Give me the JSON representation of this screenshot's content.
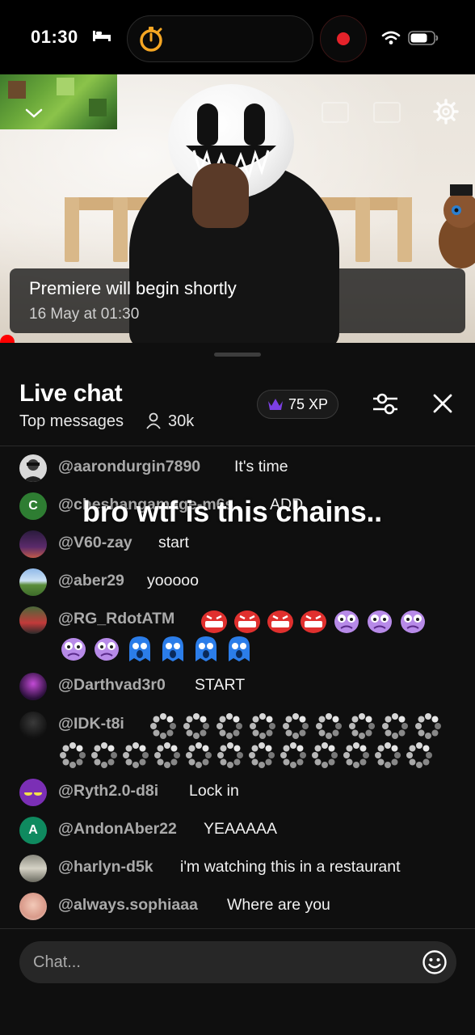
{
  "status_bar": {
    "time": "01:30",
    "icons": [
      "bed-icon",
      "timer-icon",
      "record-icon",
      "wifi-icon",
      "battery-icon"
    ]
  },
  "video": {
    "premiere_title": "Premiere will begin shortly",
    "premiere_date": "16 May at 01:30",
    "icons": [
      "collapse-chevron-icon",
      "settings-icon"
    ]
  },
  "chat": {
    "title": "Live chat",
    "mode": "Top messages",
    "viewers": "30k",
    "xp": "75 XP",
    "messages": [
      {
        "author": "@aarondurgin7890",
        "text": "It's time"
      },
      {
        "author": "@cheshangamage-m6s",
        "text": "ADD",
        "avatar_letter": "C",
        "avatar_color": "#2e7d32"
      },
      {
        "author": "@V60-zay",
        "text": "start"
      },
      {
        "author": "@aber29",
        "text": "yooooo"
      },
      {
        "author": "@RG_RdotATM",
        "text": ""
      },
      {
        "author": "@Darthvad3r0",
        "text": "START"
      },
      {
        "author": "@IDK-t8i",
        "text": ""
      },
      {
        "author": "@Ryth2.0-d8i",
        "text": "Lock in"
      },
      {
        "author": "@AndonAber22",
        "text": "YEAAAAA",
        "avatar_letter": "A",
        "avatar_color": "#0f8a5f"
      },
      {
        "author": "@harlyn-d5k",
        "text": "i'm watching this in a restaurant"
      },
      {
        "author": "@always.sophiaaa",
        "text": "Where are you"
      }
    ],
    "input_placeholder": "Chat..."
  },
  "overlay_caption": "bro wtf is this chains..",
  "colors": {
    "background": "#0f0f0f",
    "author": "#aaaaaa",
    "record_red": "#e5222a",
    "accent_orange": "#f5a623",
    "xp_purple": "#7b3fe4"
  }
}
